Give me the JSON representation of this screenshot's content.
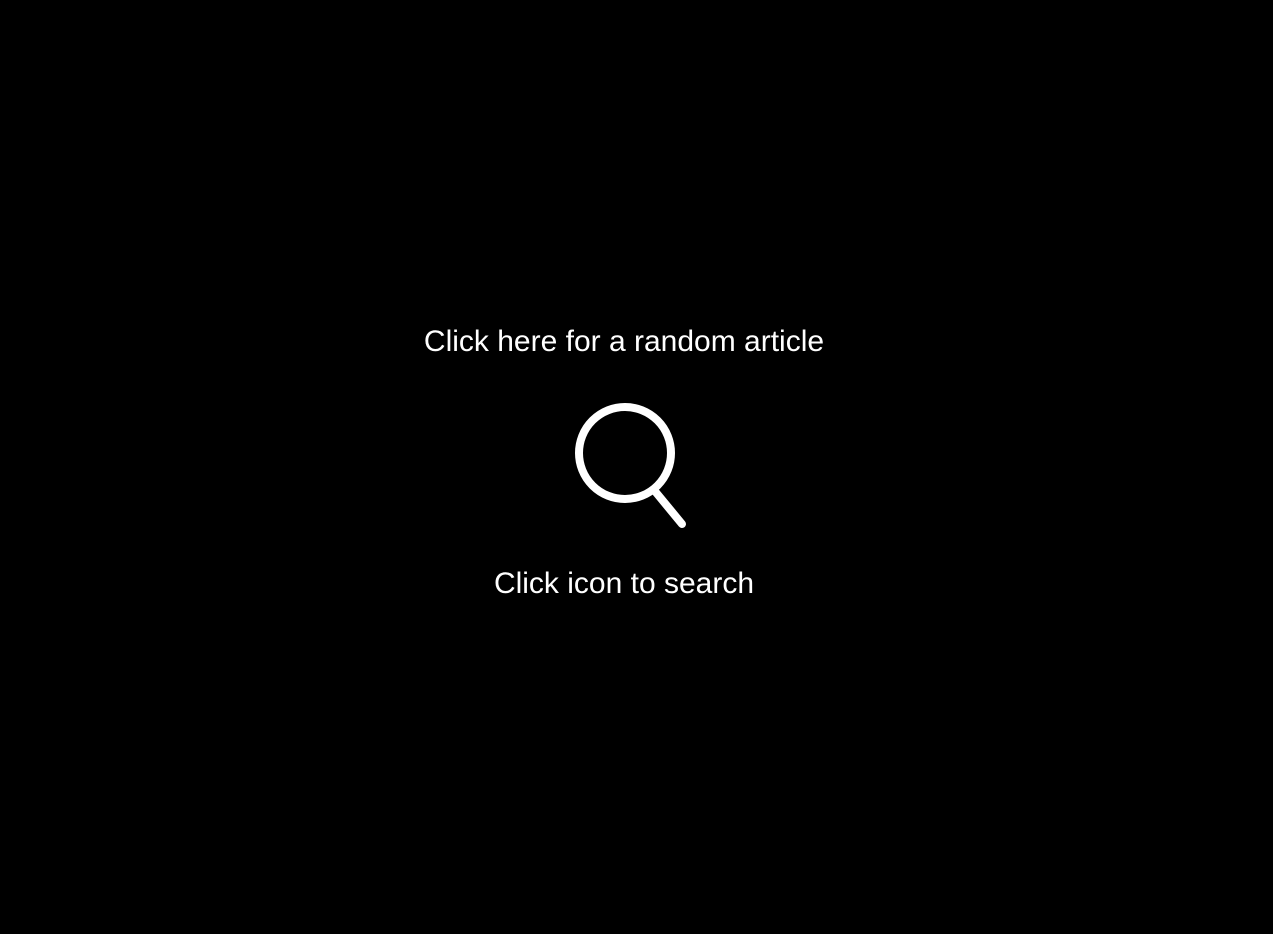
{
  "main": {
    "random_article_label": "Click here for a random article",
    "search_hint": "Click icon to search",
    "search_icon": "search-icon"
  },
  "colors": {
    "background": "#000000",
    "foreground": "#ffffff"
  }
}
